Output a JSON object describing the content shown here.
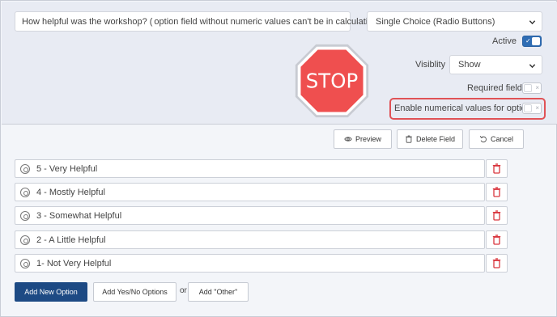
{
  "question": {
    "text_before": "How helpful was the workshop? (",
    "text_after": " option field without numeric values can't be in calculations)"
  },
  "field_type": {
    "selected": "Single Choice (Radio Buttons)"
  },
  "active": {
    "label": "Active",
    "enabled": true
  },
  "visibility": {
    "label": "Visiblity",
    "selected": "Show"
  },
  "required": {
    "label": "Required field",
    "enabled": false
  },
  "numerical_values": {
    "label": "Enable numerical values for options",
    "enabled": false
  },
  "stop_sign": {
    "text": "STOP"
  },
  "toolbar": {
    "preview_label": "Preview",
    "delete_label": "Delete Field",
    "cancel_label": "Cancel"
  },
  "options": [
    {
      "label": "5 - Very Helpful"
    },
    {
      "label": "4 - Mostly Helpful"
    },
    {
      "label": "3 - Somewhat Helpful"
    },
    {
      "label": "2 - A Little Helpful"
    },
    {
      "label": "1- Not Very Helpful"
    }
  ],
  "actions": {
    "add_option_label": "Add New Option",
    "add_yes_no_label": "Add Yes/No Options",
    "or_label": "or",
    "add_other_label": "Add \"Other\""
  },
  "colors": {
    "primary": "#1d4a84",
    "toggle_on": "#2f6db4",
    "stop_red": "#ef4f4f",
    "highlight_red": "#e05256",
    "trash_red": "#d9363e"
  }
}
